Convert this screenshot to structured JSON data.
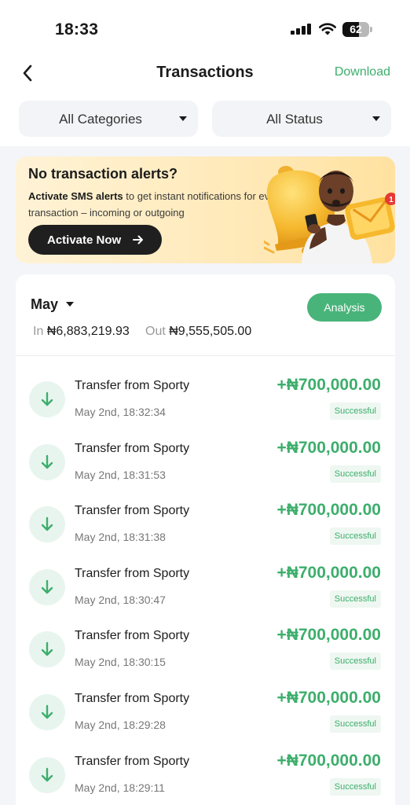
{
  "status_bar": {
    "time": "18:33",
    "battery": "62",
    "battery_level": 0.62
  },
  "nav": {
    "title": "Transactions",
    "download": "Download"
  },
  "filters": {
    "category": "All Categories",
    "status": "All Status"
  },
  "banner": {
    "title": "No transaction alerts?",
    "text_bold": "Activate SMS alerts",
    "text_rest": " to get instant notifications for every transaction – incoming or outgoing",
    "button": "Activate Now",
    "envelope_badge": "1"
  },
  "summary": {
    "month": "May",
    "in_label": "In",
    "in_value": "₦6,883,219.93",
    "out_label": "Out",
    "out_value": "₦9,555,505.00",
    "analysis": "Analysis"
  },
  "transactions": [
    {
      "name": "Transfer from Sporty",
      "time": "May 2nd, 18:32:34",
      "amount": "+₦700,000.00",
      "status": "Successful"
    },
    {
      "name": "Transfer from Sporty",
      "time": "May 2nd, 18:31:53",
      "amount": "+₦700,000.00",
      "status": "Successful"
    },
    {
      "name": "Transfer from Sporty",
      "time": "May 2nd, 18:31:38",
      "amount": "+₦700,000.00",
      "status": "Successful"
    },
    {
      "name": "Transfer from Sporty",
      "time": "May 2nd, 18:30:47",
      "amount": "+₦700,000.00",
      "status": "Successful"
    },
    {
      "name": "Transfer from Sporty",
      "time": "May 2nd, 18:30:15",
      "amount": "+₦700,000.00",
      "status": "Successful"
    },
    {
      "name": "Transfer from Sporty",
      "time": "May 2nd, 18:29:28",
      "amount": "+₦700,000.00",
      "status": "Successful"
    },
    {
      "name": "Transfer from Sporty",
      "time": "May 2nd, 18:29:11",
      "amount": "+₦700,000.00",
      "status": "Successful"
    }
  ],
  "icons": {
    "back": "chevron-left-icon",
    "incoming": "arrow-down-icon",
    "dropdown": "caret-down-icon"
  },
  "colors": {
    "accent": "#3dae6c",
    "analysis_bg": "#49b47a",
    "banner_bg": "#ffeabd"
  }
}
